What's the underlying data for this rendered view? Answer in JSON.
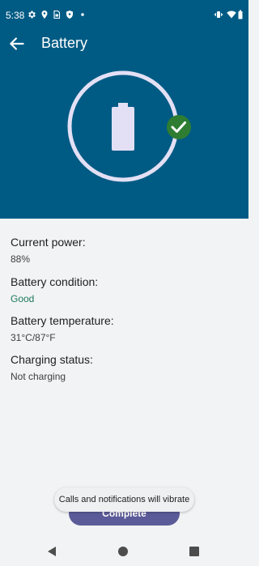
{
  "status_bar": {
    "time": "5:38",
    "left_icons": [
      "settings-icon",
      "location-icon",
      "sim-icon",
      "shield-icon",
      "dot-icon"
    ],
    "right_icons": [
      "vibrate-icon",
      "wifi-icon",
      "battery-icon"
    ]
  },
  "app_bar": {
    "title": "Battery",
    "back_icon": "arrow-back-icon"
  },
  "hero": {
    "background_color": "#005b84",
    "ring_color": "#e3e0f5",
    "check_badge_color": "#2e7d32",
    "battery_icon": "battery-full-icon",
    "status_icon": "check-circle-icon"
  },
  "details": [
    {
      "label": "Current power:",
      "value": "88%"
    },
    {
      "label": "Battery condition:",
      "value": "Good"
    },
    {
      "label": "Battery temperature:",
      "value": "31°C/87°F"
    },
    {
      "label": "Charging status:",
      "value": "Not charging"
    }
  ],
  "complete_button": {
    "label": "Complete"
  },
  "toast": {
    "text": "Calls and notifications will vibrate"
  },
  "nav_bar": {
    "icons": [
      "nav-back-icon",
      "nav-home-icon",
      "nav-recents-icon"
    ]
  }
}
